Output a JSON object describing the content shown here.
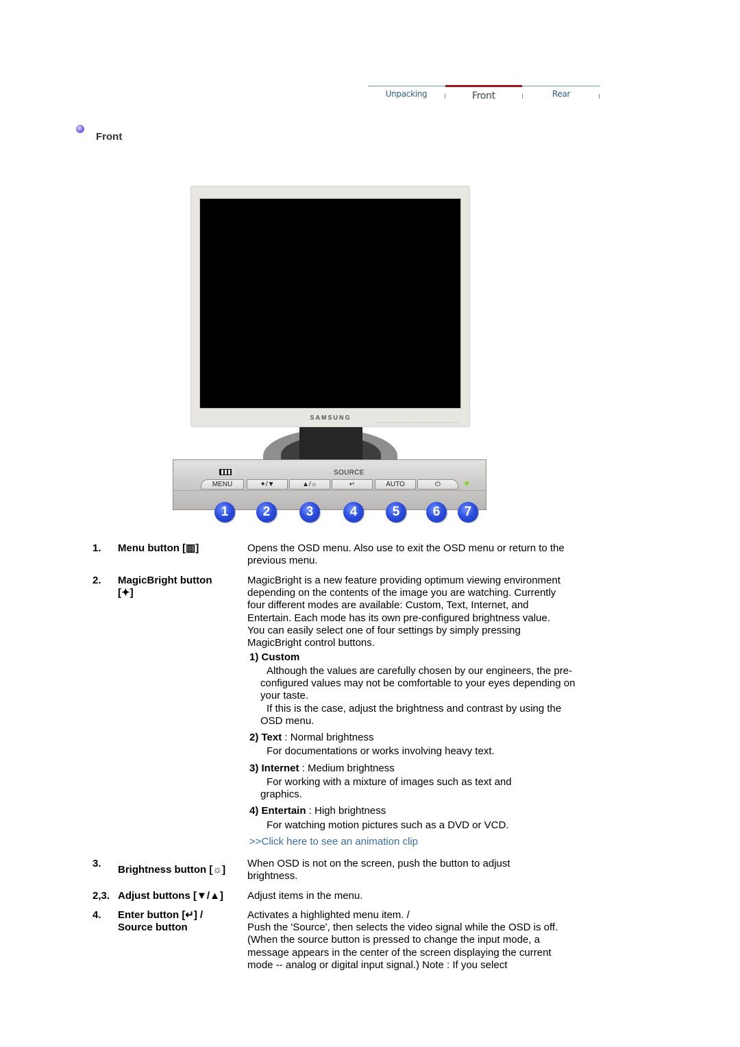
{
  "nav": {
    "tabs": [
      {
        "label": "Unpacking",
        "active": false
      },
      {
        "label": "Front",
        "active": true
      },
      {
        "label": "Rear",
        "active": false
      }
    ],
    "active_color": "#a0131a"
  },
  "section": {
    "title": "Front"
  },
  "monitor": {
    "brand": "SAMSUNG",
    "panel": {
      "source_label": "SOURCE",
      "buttons": [
        {
          "label": "MENU",
          "icon": "menu-icon"
        },
        {
          "label": "▲/▼",
          "icon": "magicbright-down-icon",
          "display": "✦/▼"
        },
        {
          "label": "▲/☼",
          "icon": "up-brightness-icon",
          "display": "▲/☼"
        },
        {
          "label": "↵",
          "icon": "enter-icon",
          "display": "↵"
        },
        {
          "label": "AUTO",
          "icon": "auto-icon",
          "display": "AUTO"
        },
        {
          "label": "⏻",
          "icon": "power-icon",
          "display": "⏻"
        }
      ],
      "callouts": [
        "1",
        "2",
        "3",
        "4",
        "5",
        "6",
        "7"
      ]
    }
  },
  "items": [
    {
      "num": "1.",
      "term": "Menu button [▥]",
      "desc": "Opens the OSD menu. Also use to exit the OSD menu or return to the previous menu."
    },
    {
      "num": "2.",
      "term": "MagicBright button",
      "term2": "[✦]",
      "desc": "MagicBright is a new feature providing optimum viewing environment depending on the contents of the image you are watching. Currently four different modes are available: Custom, Text, Internet, and Entertain. Each mode has its own pre-configured brightness value. You can easily select one of four settings by simply pressing MagicBright control buttons.",
      "modes": [
        {
          "title": "1) Custom",
          "level": "",
          "lines": [
            "Although the values are carefully chosen by our engineers, the pre-configured values may not be comfortable to your eyes depending on your taste.",
            "If this is the case, adjust the brightness and contrast by using the OSD menu."
          ]
        },
        {
          "title": "2) Text",
          "level": " : Normal brightness",
          "lines": [
            "For documentations or works involving heavy text."
          ]
        },
        {
          "title": "3) Internet",
          "level": " : Medium brightness",
          "lines": [
            "For working with a mixture of images such as text and graphics."
          ]
        },
        {
          "title": "4) Entertain",
          "level": " : High brightness",
          "lines": [
            "For watching motion pictures such as a DVD or VCD."
          ]
        }
      ],
      "link": ">>Click here to see an animation clip"
    },
    {
      "num": "3.",
      "term": "Brightness button [☼]",
      "desc": "When OSD is not on the screen, push the button to adjust brightness."
    },
    {
      "num": "2,3.",
      "term": "Adjust buttons [▼/▲]",
      "desc": "Adjust items in the menu."
    },
    {
      "num": "4.",
      "term": "Enter button [↵] /",
      "term2": "Source button",
      "desc": "Activates a highlighted menu item. /",
      "desc2": "Push the 'Source', then selects the video signal while the OSD is off. (When the source button is pressed to change the input mode, a message appears in the center of the screen displaying the current mode -- analog or digital input signal.) Note : If you select"
    }
  ]
}
